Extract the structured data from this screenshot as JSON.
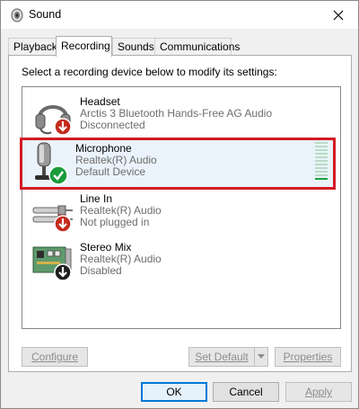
{
  "window": {
    "title": "Sound"
  },
  "tabs": [
    {
      "label": "Playback",
      "active": false
    },
    {
      "label": "Recording",
      "active": true
    },
    {
      "label": "Sounds",
      "active": false
    },
    {
      "label": "Communications",
      "active": false
    }
  ],
  "instruction": "Select a recording device below to modify its settings:",
  "devices": [
    {
      "name": "Headset",
      "description": "Arctis 3 Bluetooth Hands-Free AG Audio",
      "status": "Disconnected",
      "icon": "headset-icon",
      "badge": "red-down-arrow",
      "selected": false
    },
    {
      "name": "Microphone",
      "description": "Realtek(R) Audio",
      "status": "Default Device",
      "icon": "microphone-icon",
      "badge": "green-check",
      "selected": true
    },
    {
      "name": "Line In",
      "description": "Realtek(R) Audio",
      "status": "Not plugged in",
      "icon": "line-in-icon",
      "badge": "red-down-arrow",
      "selected": false
    },
    {
      "name": "Stereo Mix",
      "description": "Realtek(R) Audio",
      "status": "Disabled",
      "icon": "stereo-mix-icon",
      "badge": "black-down-arrow",
      "selected": false
    }
  ],
  "buttons": {
    "configure": "Configure",
    "set_default": "Set Default",
    "properties": "Properties",
    "ok": "OK",
    "cancel": "Cancel",
    "apply": "Apply"
  },
  "colors": {
    "selection_outline": "#d21b24",
    "selection_fill": "#eaf3fb",
    "default_badge": "#1a9b3c",
    "unavailable_badge": "#c42b1c",
    "primary_button_border": "#0078d7"
  }
}
